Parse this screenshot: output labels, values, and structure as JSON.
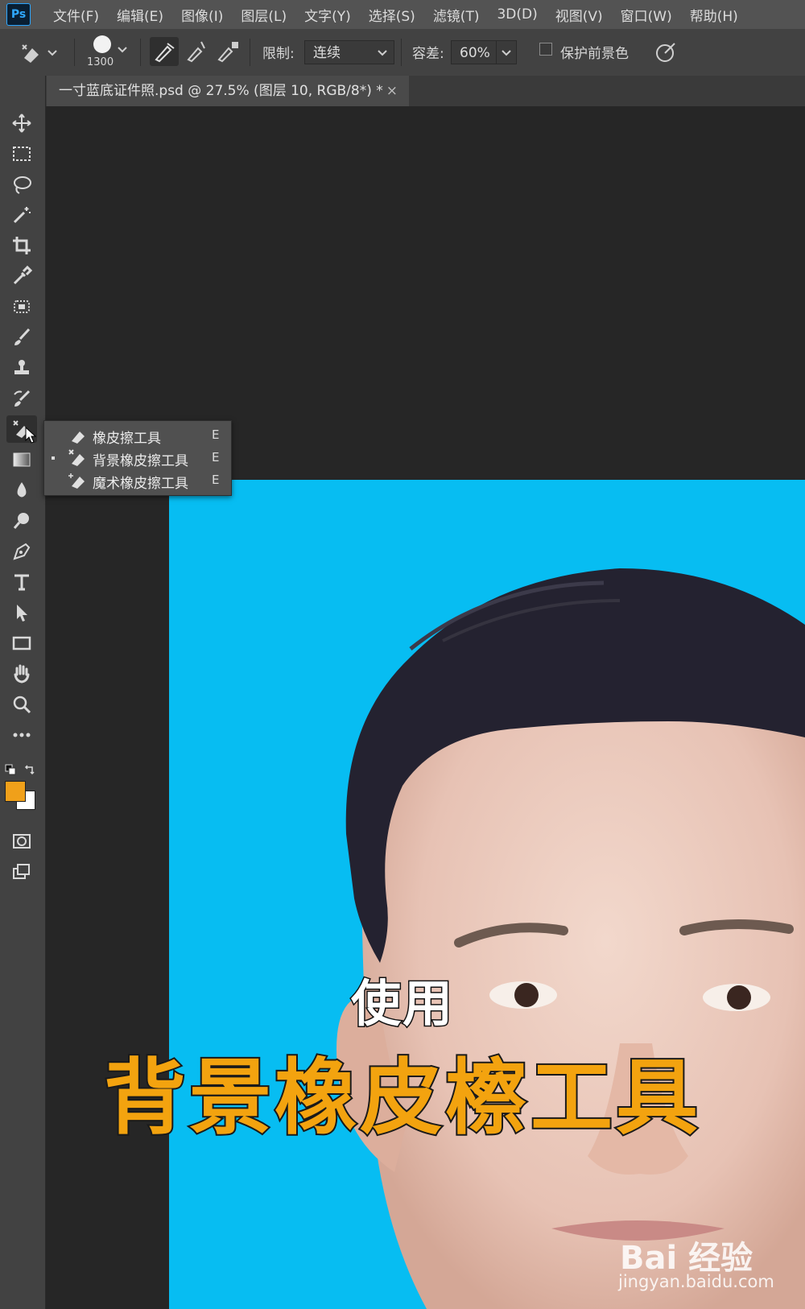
{
  "app": {
    "logo": "Ps"
  },
  "menubar": {
    "items": [
      "文件(F)",
      "编辑(E)",
      "图像(I)",
      "图层(L)",
      "文字(Y)",
      "选择(S)",
      "滤镜(T)",
      "3D(D)",
      "视图(V)",
      "窗口(W)",
      "帮助(H)"
    ]
  },
  "options": {
    "brush_size": "1300",
    "limit_label": "限制:",
    "limit_value": "连续",
    "tolerance_label": "容差:",
    "tolerance_value": "60%",
    "protect_label": "保护前景色",
    "protect_checked": false
  },
  "document": {
    "tab_title": "一寸蓝底证件照.psd @ 27.5% (图层 10, RGB/8*) *",
    "close": "×"
  },
  "flyout": {
    "items": [
      {
        "label": "橡皮擦工具",
        "key": "E",
        "active": false
      },
      {
        "label": "背景橡皮擦工具",
        "key": "E",
        "active": true
      },
      {
        "label": "魔术橡皮擦工具",
        "key": "E",
        "active": false
      }
    ]
  },
  "captions": {
    "line1": "使用",
    "line2": "背景橡皮檫工具"
  },
  "watermark": {
    "brand": "Bai 经验",
    "url": "jingyan.baidu.com"
  },
  "colors": {
    "foreground": "#f0a01a",
    "background": "#ffffff",
    "photo_bg": "#07bdf2",
    "caption_yellow": "#f3a30f"
  },
  "toolbar": {
    "icons": [
      "move-icon",
      "marquee-icon",
      "lasso-icon",
      "magic-wand-icon",
      "crop-icon",
      "eyedropper-icon",
      "healing-brush-icon",
      "brush-icon",
      "clone-stamp-icon",
      "history-brush-icon",
      "eraser-icon",
      "gradient-icon",
      "blur-icon",
      "dodge-icon",
      "pen-icon",
      "type-icon",
      "path-selection-icon",
      "rectangle-icon",
      "hand-icon",
      "zoom-icon",
      "more-tools-icon"
    ]
  }
}
